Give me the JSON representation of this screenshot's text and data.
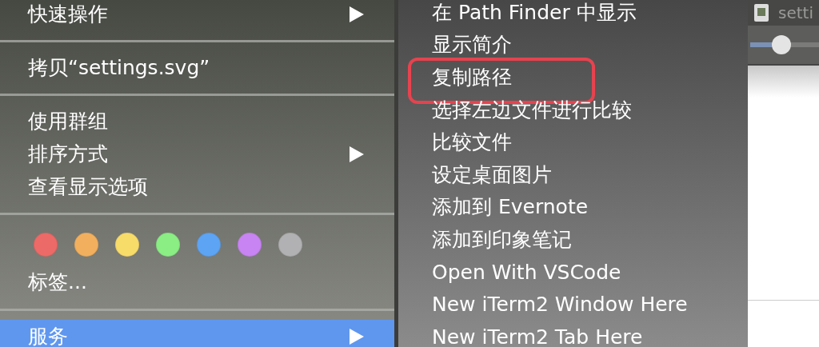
{
  "menu": [
    {
      "kind": "item",
      "label": "快速操作",
      "has_submenu": true,
      "selected": false
    },
    {
      "kind": "separator"
    },
    {
      "kind": "item",
      "label": "拷贝“settings.svg”",
      "has_submenu": false,
      "selected": false
    },
    {
      "kind": "separator"
    },
    {
      "kind": "item",
      "label": "使用群组",
      "has_submenu": false,
      "selected": false
    },
    {
      "kind": "item",
      "label": "排序方式",
      "has_submenu": true,
      "selected": false
    },
    {
      "kind": "item",
      "label": "查看显示选项",
      "has_submenu": false,
      "selected": false
    },
    {
      "kind": "separator"
    },
    {
      "kind": "tags",
      "label": "标签...",
      "tags": [
        {
          "color": "#ec6a67"
        },
        {
          "color": "#f2b05e"
        },
        {
          "color": "#f8dc6a"
        },
        {
          "color": "#8aee84"
        },
        {
          "color": "#5ea4f4"
        },
        {
          "color": "#c884f2"
        },
        {
          "color": "#b1b1b3"
        }
      ]
    },
    {
      "kind": "separator"
    },
    {
      "kind": "item",
      "label": "服务",
      "has_submenu": true,
      "selected": true
    }
  ],
  "submenu": [
    {
      "label": "在 Path Finder 中显示",
      "highlighted": false
    },
    {
      "label": "显示简介",
      "highlighted": false
    },
    {
      "label": "复制路径",
      "highlighted": true
    },
    {
      "label": "选择左边文件进行比较",
      "highlighted": false
    },
    {
      "label": "比较文件",
      "highlighted": false
    },
    {
      "label": "设定桌面图片",
      "highlighted": false
    },
    {
      "label": "添加到 Evernote",
      "highlighted": false
    },
    {
      "label": "添加到印象笔记",
      "highlighted": false
    },
    {
      "label": "Open With VSCode",
      "highlighted": false
    },
    {
      "label": "New iTerm2 Window Here",
      "highlighted": false
    },
    {
      "label": "New iTerm2 Tab Here",
      "highlighted": false
    }
  ],
  "window": {
    "title": "setti",
    "slider": {
      "level": 0.45
    }
  }
}
